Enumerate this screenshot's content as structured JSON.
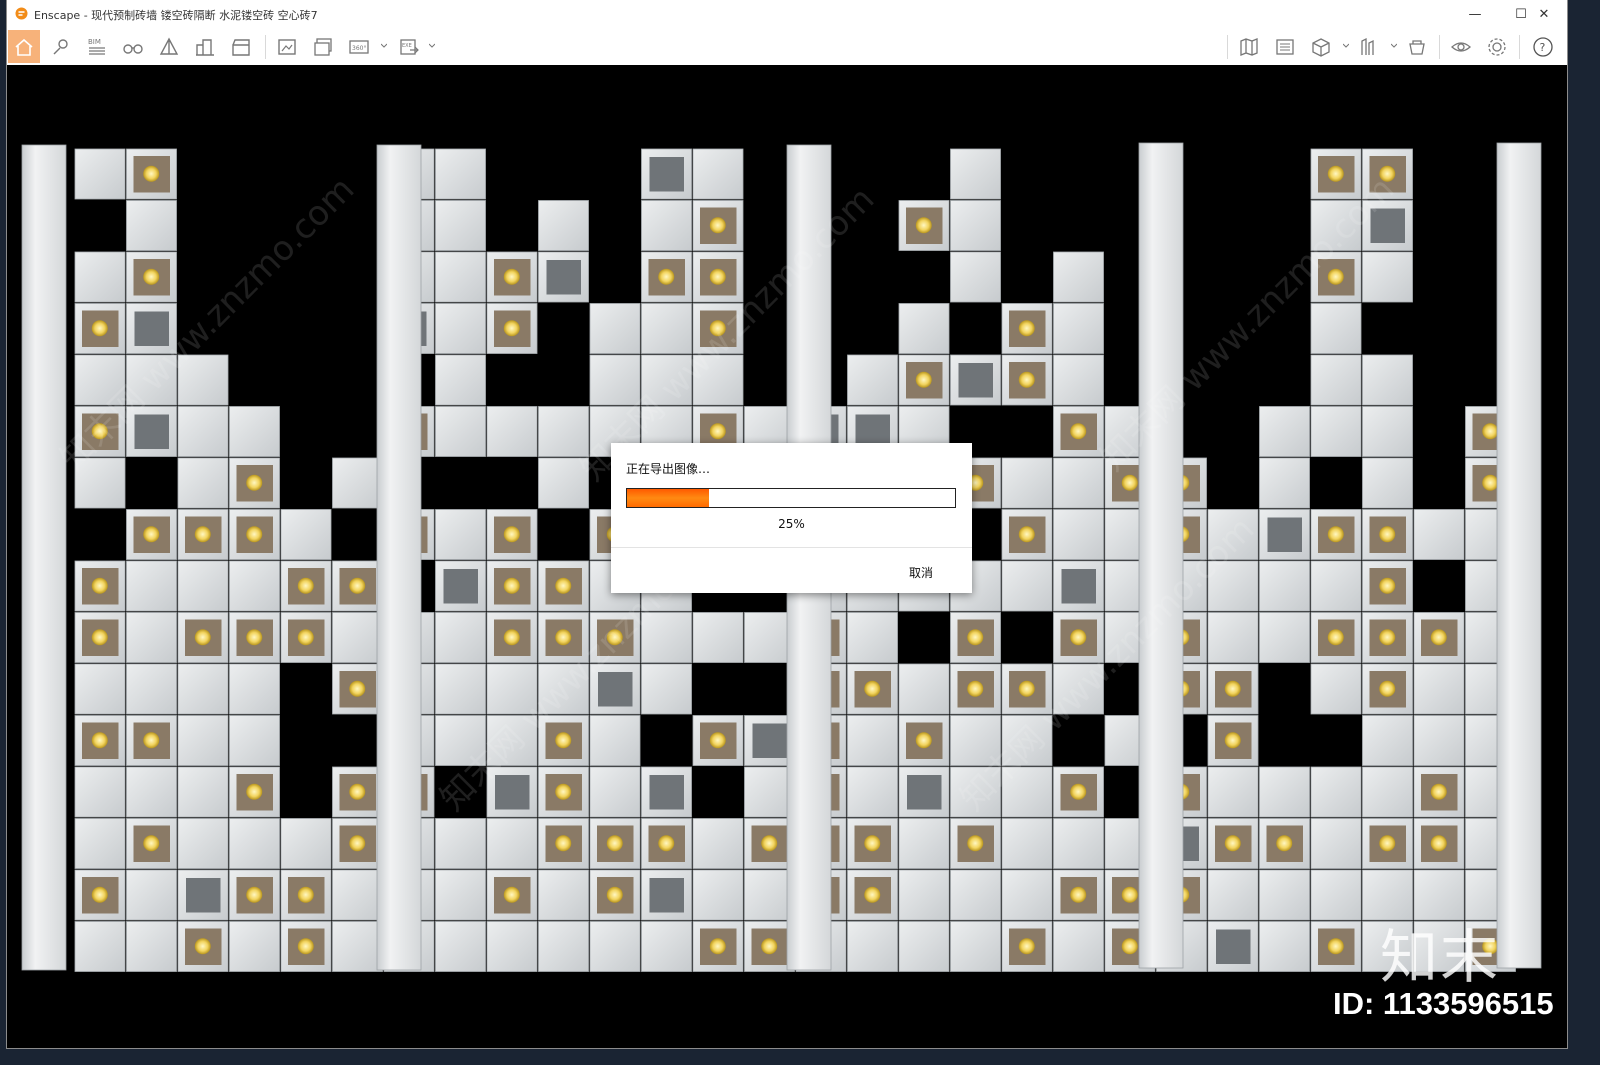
{
  "window": {
    "app_name": "Enscape",
    "title": "Enscape - 现代预制砖墙 镂空砖隔断 水泥镂空砖 空心砖7",
    "controls": {
      "minimize": "—",
      "maximize": "☐",
      "close": "✕"
    }
  },
  "toolbar": {
    "left_tools": [
      "home-icon",
      "views-icon",
      "bim-icon",
      "binoculars-icon",
      "perspective-icon",
      "buildings-icon",
      "clapper-icon",
      "screenshot-icon",
      "batch-render-icon",
      "panorama-icon",
      "export-exe-icon"
    ],
    "right_tools": [
      "map-icon",
      "archive-icon",
      "cube-icon",
      "ruler-icon",
      "asset-library-icon",
      "visual-settings-icon",
      "settings-icon",
      "help-icon"
    ],
    "bim_label": "BIM",
    "panorama_label": "360°",
    "exe_label": "EXE"
  },
  "dialog": {
    "title": "正在导出图像…",
    "progress": 0.25,
    "percent_text": "25%",
    "cancel_label": "取消"
  },
  "watermark": {
    "logo": "知末",
    "id_text": "ID: 1133596515",
    "diagonal_text": "知末网 www.znzmo.com"
  },
  "colors": {
    "accent": "#ff7a00",
    "home_button_bg": "#f7b27a",
    "viewport_bg": "#000000",
    "brick": "#d9dbdd",
    "light": "#f4d86a"
  }
}
